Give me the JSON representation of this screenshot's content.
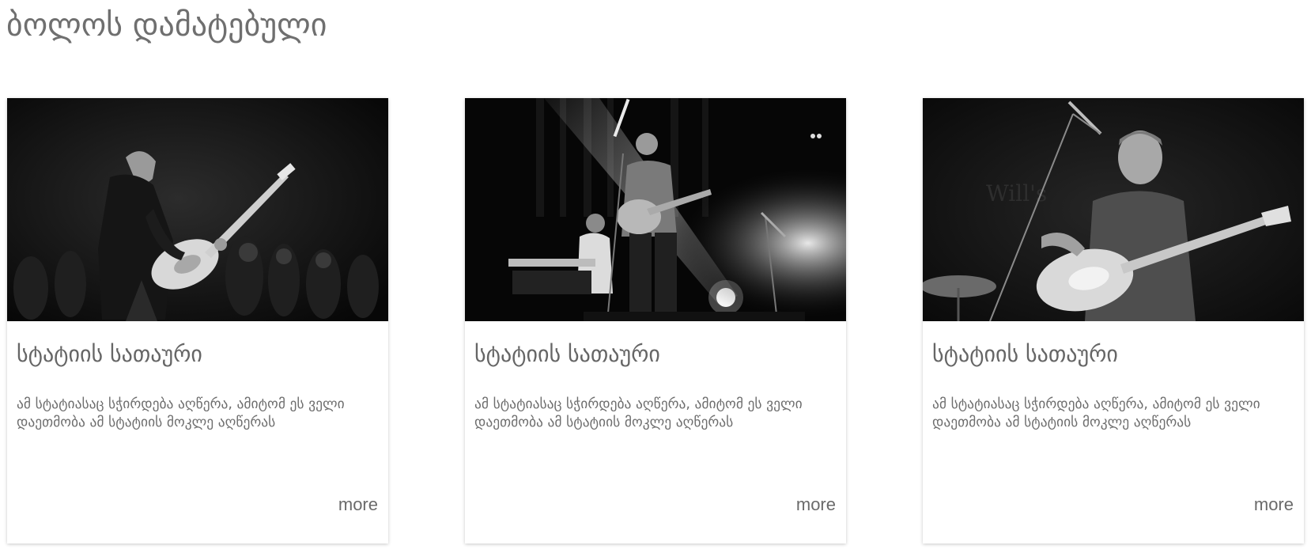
{
  "section": {
    "title": "ბოლოს დამატებული"
  },
  "cards": [
    {
      "image": "concert-photo-guitarist-crowd",
      "title": "სტატიის სათაური",
      "description": "ამ სტატიასაც სჭირდება აღწერა, ამიტომ ეს ველი დაეთმობა ამ სტატიის მოკლე აღწერას",
      "more_label": "more"
    },
    {
      "image": "concert-photo-band-stage-lights",
      "title": "სტატიის სათაური",
      "description": "ამ სტატიასაც სჭირდება აღწერა, ამიტომ ეს ველი დაეთმობა ამ სტატიის მოკლე აღწერას",
      "more_label": "more"
    },
    {
      "image": "concert-photo-guitarist-closeup",
      "title": "სტატიის სათაური",
      "description": "ამ სტატიასაც სჭირდება აღწერა, ამიტომ ეს ველი დაეთმობა ამ სტატიის მოკლე აღწერას",
      "more_label": "more"
    }
  ]
}
